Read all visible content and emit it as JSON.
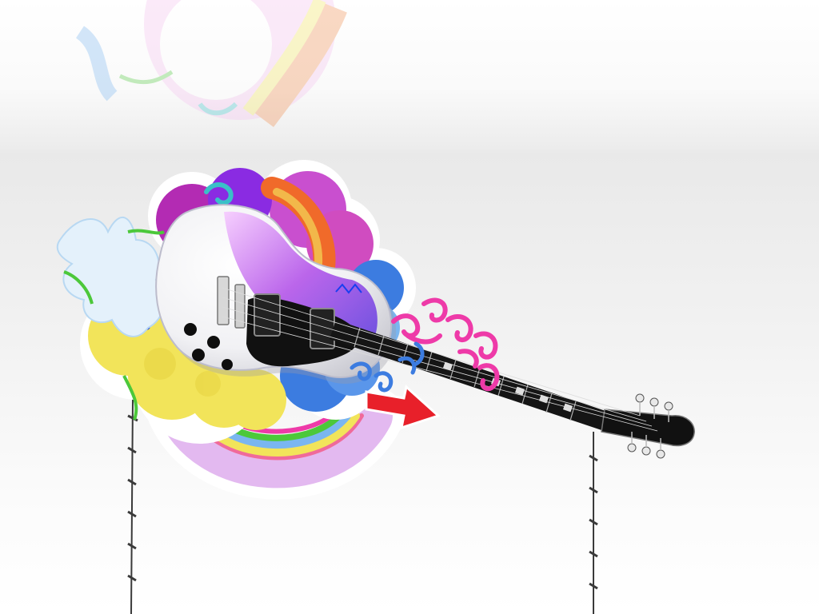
{
  "scene": {
    "description_label": "",
    "background": {
      "top": "#ffffff",
      "band": "#e9e9e9",
      "bottom": "#ffffff"
    },
    "palette": {
      "yellow": "#f2e45a",
      "lime": "#9fe05a",
      "blue": "#3c7ce0",
      "light_blue": "#7ab6f0",
      "purple": "#b32bb3",
      "magenta": "#d04cc0",
      "violet": "#8a2be2",
      "orange": "#f06a2a",
      "pink": "#ee3aa8",
      "teal": "#3ac0c8",
      "red": "#e8202a",
      "green": "#4cc83a",
      "guitar_body": "#f4f4f6",
      "guitar_neck": "#151515"
    },
    "icons": [
      "guitar-icon",
      "barbed-wire-icon",
      "arrow-icon",
      "rainbow-icon",
      "splash-icon",
      "swirl-icon"
    ]
  }
}
